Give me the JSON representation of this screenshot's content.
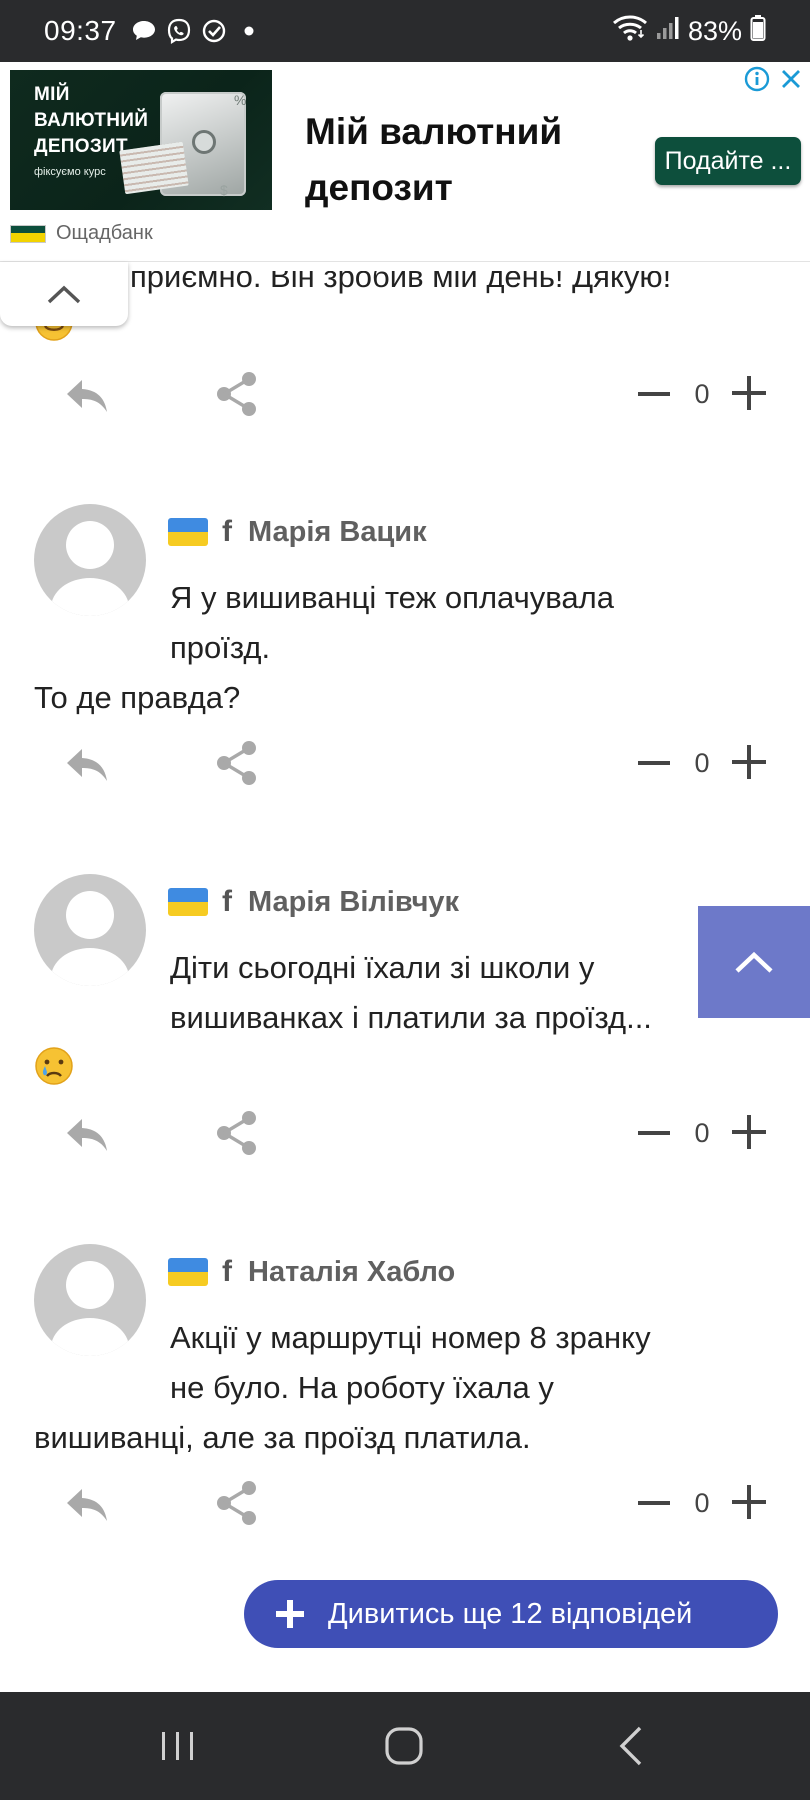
{
  "status_bar": {
    "time": "09:37",
    "battery": "83%"
  },
  "ad": {
    "image_title": "МІЙ ВАЛЮТНИЙ ДЕПОЗИТ",
    "image_subtitle": "фіксуємо курс",
    "headline_line1": "Мій валютний",
    "headline_line2": "депозит",
    "cta": "Подайте ...",
    "brand": "Ощадбанк",
    "colors": {
      "brand_green": "#0d4f3c"
    }
  },
  "partial_comment": {
    "text": "приємно. Він зробив мій день! Дякую!",
    "emoji": "smiling-face"
  },
  "comments": [
    {
      "author": "Марія Вацик",
      "lines": [
        "Я у вишиванці теж оплачувала",
        "проїзд.",
        "То де правда?"
      ],
      "votes": "0"
    },
    {
      "author": "Марія Вілівчук",
      "lines": [
        "Діти сьогодні їхали зі школи  у",
        "вишиванках і платили за проїзд..."
      ],
      "emoji": "crying-face",
      "votes": "0"
    },
    {
      "author": "Наталія Хабло",
      "lines": [
        "Акції у маршрутці номер 8 зранку",
        "не було. На роботу їхала у",
        "вишиванці, але за проїзд платила."
      ],
      "votes": "0"
    }
  ],
  "partial_votes": "0",
  "facebook_glyph": "f",
  "more_replies": "Дивитись ще 12 відповідей",
  "colors": {
    "accent": "#3f4fb6",
    "scroll_top": "#6d79c9",
    "flag_blue": "#3f8be1",
    "flag_yellow": "#f6cb22"
  }
}
